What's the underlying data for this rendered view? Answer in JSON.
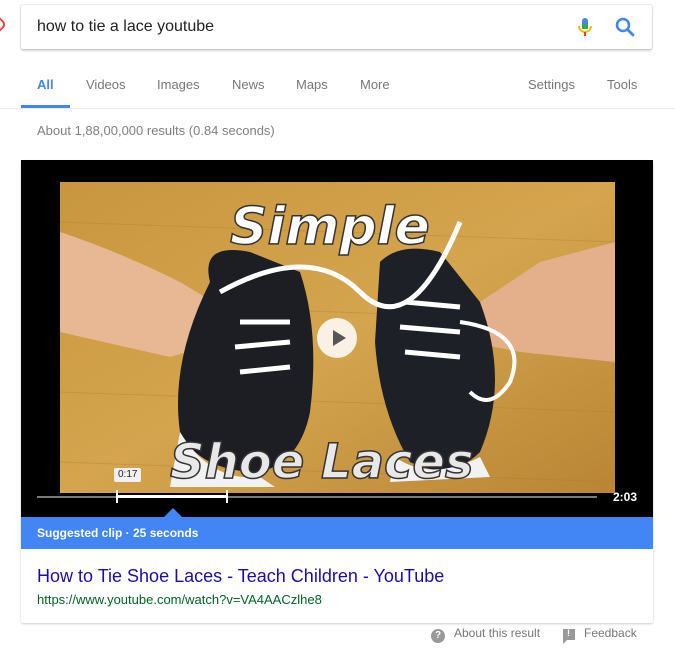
{
  "search": {
    "query": "how to tie a lace youtube"
  },
  "tabs": {
    "all": "All",
    "videos": "Videos",
    "images": "Images",
    "news": "News",
    "maps": "Maps",
    "more": "More",
    "settings": "Settings",
    "tools": "Tools"
  },
  "results_stats": "About 1,88,00,000 results (0.84 seconds)",
  "video": {
    "thumbnail_text_top": "Simple",
    "thumbnail_text_bottom": "Shoe Laces",
    "clip_start": "0:17",
    "duration": "2:03",
    "clip_label": "Suggested clip · 25 seconds"
  },
  "result": {
    "title": "How to Tie Shoe Laces - Teach Children - YouTube",
    "url": "https://www.youtube.com/watch?v=VA4AACzlhe8"
  },
  "footer": {
    "about": "About this result",
    "feedback": "Feedback"
  },
  "colors": {
    "accent": "#4285f4",
    "link": "#1a0dab",
    "url": "#006621"
  },
  "icons": [
    "mic-icon",
    "search-icon",
    "play-icon",
    "help-icon",
    "feedback-icon"
  ]
}
